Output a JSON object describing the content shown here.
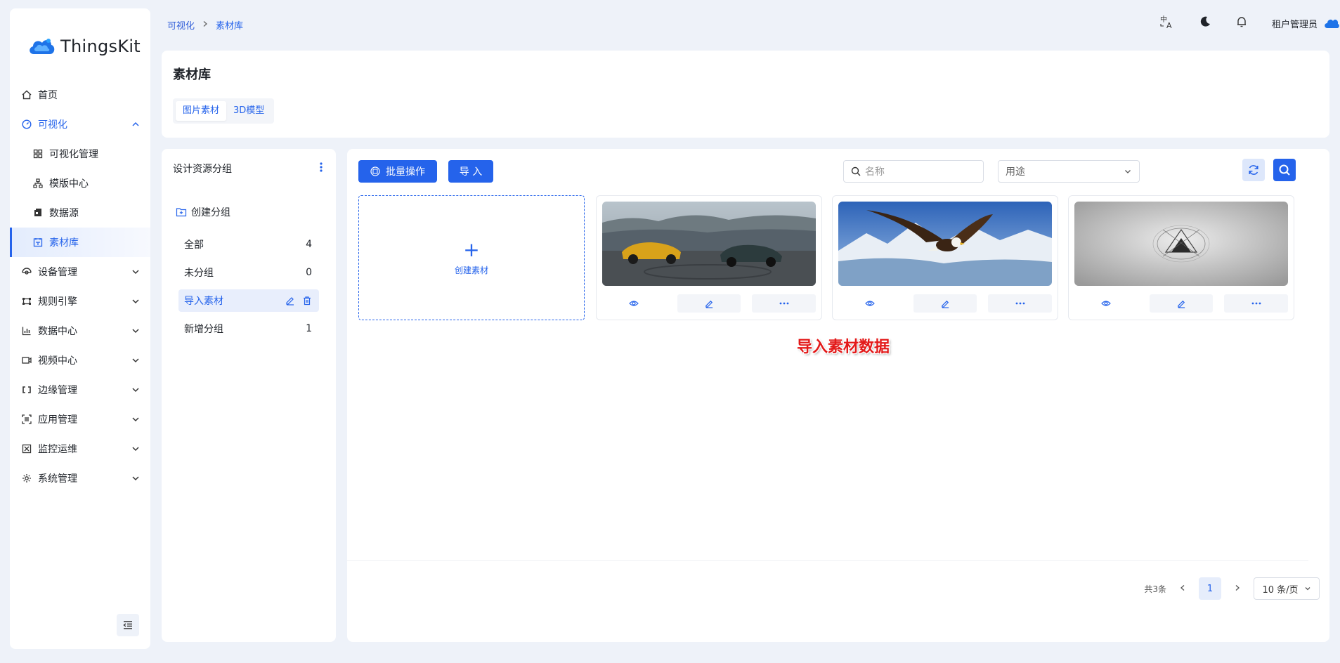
{
  "app": {
    "name": "ThingsKit"
  },
  "sidebar": {
    "items": [
      {
        "label": "首页",
        "icon": "home-icon"
      },
      {
        "label": "可视化",
        "icon": "dashboard-icon"
      },
      {
        "label": "可视化管理",
        "icon": "grid-icon"
      },
      {
        "label": "模版中心",
        "icon": "sitemap-icon"
      },
      {
        "label": "数据源",
        "icon": "database-icon"
      },
      {
        "label": "素材库",
        "icon": "picture-icon"
      },
      {
        "label": "设备管理",
        "icon": "device-icon"
      },
      {
        "label": "规则引擎",
        "icon": "rule-icon"
      },
      {
        "label": "数据中心",
        "icon": "chart-icon"
      },
      {
        "label": "视频中心",
        "icon": "video-icon"
      },
      {
        "label": "边缘管理",
        "icon": "edge-icon"
      },
      {
        "label": "应用管理",
        "icon": "app-icon"
      },
      {
        "label": "监控运维",
        "icon": "monitor-icon"
      },
      {
        "label": "系统管理",
        "icon": "settings-icon"
      }
    ]
  },
  "breadcrumb": {
    "parent": "可视化",
    "current": "素材库"
  },
  "header": {
    "username": "租户管理员"
  },
  "page": {
    "title": "素材库",
    "tabs": [
      {
        "label": "图片素材"
      },
      {
        "label": "3D模型"
      }
    ]
  },
  "groups": {
    "title": "设计资源分组",
    "create_label": "创建分组",
    "items": [
      {
        "label": "全部",
        "count": "4"
      },
      {
        "label": "未分组",
        "count": "0"
      },
      {
        "label": "导入素材",
        "count": ""
      },
      {
        "label": "新增分组",
        "count": "1"
      }
    ]
  },
  "toolbar": {
    "batch_label": "批量操作",
    "import_label": "导 入",
    "search_placeholder": "名称",
    "purpose_placeholder": "用途"
  },
  "materials": {
    "create_label": "创建素材",
    "items": [
      {
        "image": "sports-cars-photo"
      },
      {
        "image": "eagle-photo"
      },
      {
        "image": "abstract-logo-photo"
      }
    ]
  },
  "overlay_text": "导入素材数据",
  "pagination": {
    "total": "共3条",
    "current": "1",
    "page_size": "10 条/页"
  },
  "colors": {
    "primary": "#2563eb",
    "background": "#eef2f9",
    "selected_bg": "#e8eefc"
  }
}
